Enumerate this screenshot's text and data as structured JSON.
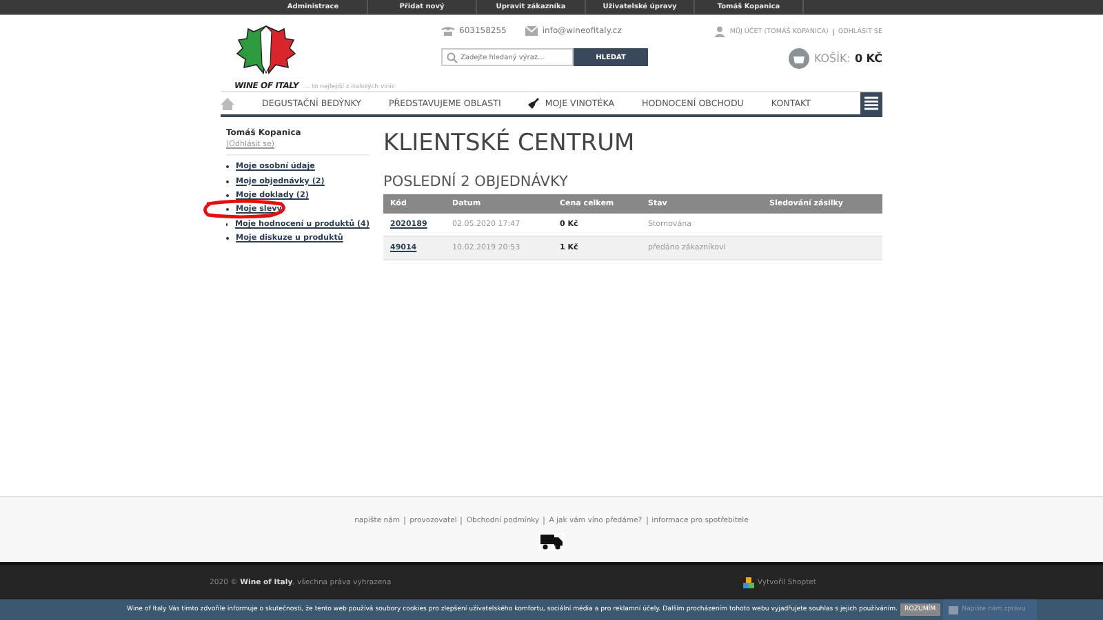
{
  "admin_bar": {
    "items": [
      "Administrace",
      "Přidat nový",
      "Upravit zákazníka",
      "Uživatelské úpravy",
      "Tomáš Kopanica"
    ]
  },
  "header": {
    "logo_text": "WINE OF ITALY",
    "tagline": "... to nejlepší z italských vinic",
    "phone": "603158255",
    "email": "info@wineofitaly.cz",
    "search": {
      "placeholder": "Zadejte hledaný výraz...",
      "button": "HLEDAT"
    },
    "account": "MŮJ ÚČET (TOMÁŠ KOPANICA)",
    "logout": "ODHLÁSIT SE",
    "cart_label": "KOŠÍK:",
    "cart_total": "0 KČ"
  },
  "nav": {
    "items": [
      {
        "label": "DEGUSTAČNÍ BEDÝNKY",
        "kind": "text"
      },
      {
        "label": "PŘEDSTAVUJEME OBLASTI",
        "kind": "text"
      },
      {
        "label": "MOJE VINOTÉKA",
        "kind": "bottle"
      },
      {
        "label": "HODNOCENÍ OBCHODU",
        "kind": "text"
      },
      {
        "label": "KONTAKT",
        "kind": "text"
      }
    ]
  },
  "sidebar": {
    "user": "Tomáš Kopanica",
    "logout": "(Odhlásit se)",
    "items": [
      {
        "label": "Moje osobní údaje"
      },
      {
        "label": "Moje objednávky (2)"
      },
      {
        "label": "Moje doklady (2)"
      },
      {
        "label": "Moje slevy"
      },
      {
        "label": "Moje hodnocení u produktů (4)"
      },
      {
        "label": "Moje diskuze u produktů"
      }
    ]
  },
  "main": {
    "title": "KLIENTSKÉ CENTRUM",
    "subtitle": "POSLEDNÍ 2 OBJEDNÁVKY",
    "table": {
      "columns": [
        "Kód",
        "Datum",
        "Cena celkem",
        "Stav",
        "Sledování zásilky"
      ],
      "rows": [
        [
          "2020189",
          "02.05.2020 17:47",
          "0 Kč",
          "Stornována"
        ],
        [
          "49014",
          "10.02.2019 20:53",
          "1 Kč",
          "předáno zákazníkovi"
        ]
      ]
    }
  },
  "footer": {
    "links": [
      "napište nám",
      "provozovatel",
      "Obchodní podmínky",
      "A jak vám víno předáme?",
      "informace pro spotřebitele"
    ],
    "copyright": "2020 © **Wine of Italy**, všechna práva vyhrazena",
    "shoptet": "Vytvořil Shoptet"
  },
  "cookie_bar": {
    "text": "Wine of Italy  Vás tímto zdvořile informuje o skutečnosti, že tento web používá soubory cookies pro zlepšení uživatelského komfortu, sociální média a pro reklamní účely. Dalším procházením tohoto webu vyjadřujete souhlas s jejich používáním.",
    "button": "ROZUMÍM",
    "chat": "Napište nám zprávu"
  }
}
